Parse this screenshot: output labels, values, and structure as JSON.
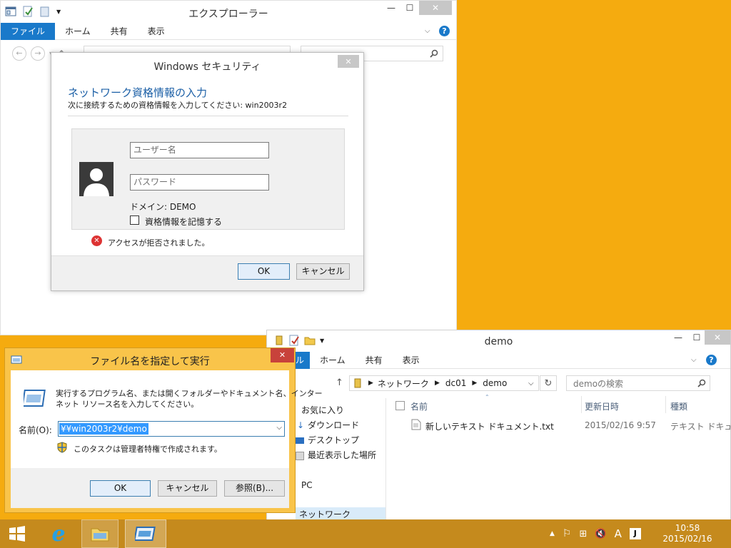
{
  "explorer1": {
    "title": "エクスプローラー",
    "tabs": [
      "ファイル",
      "ホーム",
      "共有",
      "表示"
    ],
    "minimize": "—",
    "maximize": "☐",
    "close": "✕"
  },
  "security": {
    "title": "Windows セキュリティ",
    "heading": "ネットワーク資格情報の入力",
    "subheading": "次に接続するための資格情報を入力してください: win2003r2",
    "username_placeholder": "ユーザー名",
    "password_placeholder": "パスワード",
    "domain": "ドメイン: DEMO",
    "remember": "資格情報を記憶する",
    "error": "アクセスが拒否されました。",
    "ok": "OK",
    "cancel": "キャンセル"
  },
  "run": {
    "title": "ファイル名を指定して実行",
    "description_line1": "実行するプログラム名、または開くフォルダーやドキュメント名、インター",
    "description_line2": "ネット リソース名を入力してください。",
    "name_label": "名前(O):",
    "name_value": "¥¥win2003r2¥demo",
    "admin_note": "このタスクは管理者特権で作成されます。",
    "ok": "OK",
    "cancel": "キャンセル",
    "browse": "参照(B)..."
  },
  "demo": {
    "title": "demo",
    "tabs": [
      "ル",
      "ホーム",
      "共有",
      "表示"
    ],
    "breadcrumb": [
      "ネットワーク",
      "dc01",
      "demo"
    ],
    "search_placeholder": "demoの検索",
    "columns": [
      "名前",
      "更新日時",
      "種類"
    ],
    "files": [
      {
        "name": "新しいテキスト ドキュメント.txt",
        "modified": "2015/02/16 9:57",
        "type": "テキスト ドキュ"
      }
    ],
    "nav": [
      "お気に入り",
      "ダウンロード",
      "デスクトップ",
      "最近表示した場所",
      "PC",
      "ネットワーク"
    ]
  },
  "taskbar": {
    "time": "10:58",
    "date": "2015/02/16",
    "ime": "A"
  },
  "colors": {
    "desktop": "#f5ab0f",
    "accent": "#1979ca",
    "run_frame": "#f9c44a"
  }
}
